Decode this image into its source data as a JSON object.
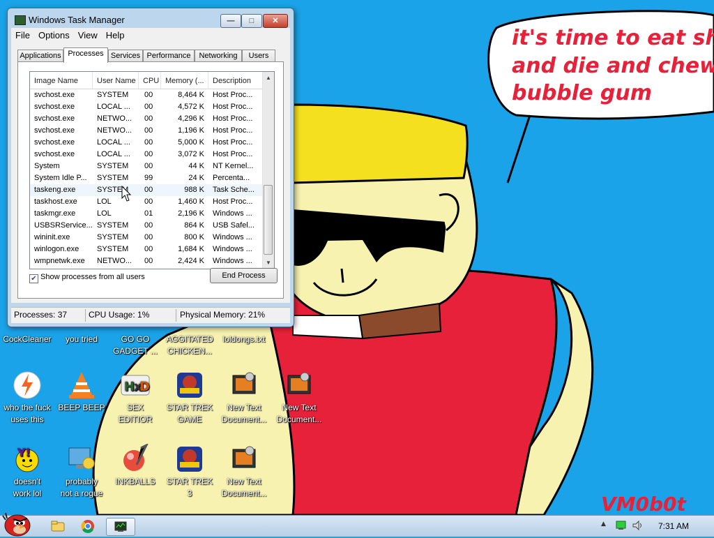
{
  "window": {
    "title": "Windows Task Manager",
    "minimize": "—",
    "maximize": "□",
    "close": "✕"
  },
  "menu": [
    "File",
    "Options",
    "View",
    "Help"
  ],
  "tabs": [
    "Applications",
    "Processes",
    "Services",
    "Performance",
    "Networking",
    "Users"
  ],
  "active_tab": "Processes",
  "columns": [
    "Image Name",
    "User Name",
    "CPU",
    "Memory (...",
    "Description"
  ],
  "processes": [
    {
      "name": "svchost.exe",
      "user": "SYSTEM",
      "cpu": "00",
      "mem": "8,464 K",
      "desc": "Host Proc..."
    },
    {
      "name": "svchost.exe",
      "user": "LOCAL ...",
      "cpu": "00",
      "mem": "4,572 K",
      "desc": "Host Proc..."
    },
    {
      "name": "svchost.exe",
      "user": "NETWO...",
      "cpu": "00",
      "mem": "4,296 K",
      "desc": "Host Proc..."
    },
    {
      "name": "svchost.exe",
      "user": "NETWO...",
      "cpu": "00",
      "mem": "1,196 K",
      "desc": "Host Proc..."
    },
    {
      "name": "svchost.exe",
      "user": "LOCAL ...",
      "cpu": "00",
      "mem": "5,000 K",
      "desc": "Host Proc..."
    },
    {
      "name": "svchost.exe",
      "user": "LOCAL ...",
      "cpu": "00",
      "mem": "3,072 K",
      "desc": "Host Proc..."
    },
    {
      "name": "System",
      "user": "SYSTEM",
      "cpu": "00",
      "mem": "44 K",
      "desc": "NT Kernel..."
    },
    {
      "name": "System Idle P...",
      "user": "SYSTEM",
      "cpu": "99",
      "mem": "24 K",
      "desc": "Percenta..."
    },
    {
      "name": "taskeng.exe",
      "user": "SYSTEM",
      "cpu": "00",
      "mem": "988 K",
      "desc": "Task Sche..."
    },
    {
      "name": "taskhost.exe",
      "user": "LOL",
      "cpu": "00",
      "mem": "1,460 K",
      "desc": "Host Proc..."
    },
    {
      "name": "taskmgr.exe",
      "user": "LOL",
      "cpu": "01",
      "mem": "2,196 K",
      "desc": "Windows ..."
    },
    {
      "name": "USBSRService...",
      "user": "SYSTEM",
      "cpu": "00",
      "mem": "864 K",
      "desc": "USB Safel..."
    },
    {
      "name": "wininit.exe",
      "user": "SYSTEM",
      "cpu": "00",
      "mem": "800 K",
      "desc": "Windows ..."
    },
    {
      "name": "winlogon.exe",
      "user": "SYSTEM",
      "cpu": "00",
      "mem": "1,684 K",
      "desc": "Windows ..."
    },
    {
      "name": "wmpnetwk.exe",
      "user": "NETWO...",
      "cpu": "00",
      "mem": "2,424 K",
      "desc": "Windows ..."
    }
  ],
  "selected_row": 8,
  "show_all_label": "Show processes from all users",
  "show_all_checked": true,
  "end_process_label": "End Process",
  "status": {
    "processes": "Processes: 37",
    "cpu": "CPU Usage: 1%",
    "memory": "Physical Memory: 21%"
  },
  "wallpaper": {
    "speech_text": "it's time to eat shit\nand die and chew\nbubble gum",
    "signature": "VM0b0t"
  },
  "desktop_icons": [
    {
      "label": "CockCleaner",
      "icon": "cockcleaner-icon"
    },
    {
      "label": "you tried",
      "icon": "you-tried-icon"
    },
    {
      "label": "GO GO\nGADGET ...",
      "icon": "gadget-icon"
    },
    {
      "label": "AGGITATED\nCHICKEN...",
      "icon": "chicken-icon"
    },
    {
      "label": "loldongs.txt",
      "icon": "text-file-icon"
    },
    {
      "label": "who the fuck\nuses this",
      "icon": "avast-icon"
    },
    {
      "label": "BEEP BEEP",
      "icon": "vlc-icon"
    },
    {
      "label": "SEX\nEDITIOR",
      "icon": "hxd-icon"
    },
    {
      "label": "STAR TREK\nGAME",
      "icon": "star-wars-game-icon"
    },
    {
      "label": "New Text\nDocument...",
      "icon": "text-document-icon"
    },
    {
      "label": "New Text\nDocument...",
      "icon": "text-document-icon"
    },
    {
      "label": "doesn't\nwork lol",
      "icon": "yahoo-messenger-icon"
    },
    {
      "label": "probably\nnot a rogue",
      "icon": "computer-settings-icon"
    },
    {
      "label": "INKBALLS",
      "icon": "inkball-icon"
    },
    {
      "label": "STAR TREK\n3",
      "icon": "star-wars-game-icon"
    },
    {
      "label": "New Text\nDocument...",
      "icon": "text-document-icon"
    }
  ],
  "taskbar": {
    "start_icon": "angry-bird-start-icon",
    "pinned": [
      "explorer-icon",
      "chrome-icon",
      "task-manager-icon"
    ],
    "tray": [
      "show-hidden-icons-arrow",
      "network-icon",
      "volume-icon"
    ],
    "clock": "7:31 AM"
  },
  "colors": {
    "background": "#1aa3e8",
    "speech_text": "#e8213a",
    "skin": "#f5f0a8",
    "hair": "#f5e020",
    "shirt": "#e8213a"
  }
}
